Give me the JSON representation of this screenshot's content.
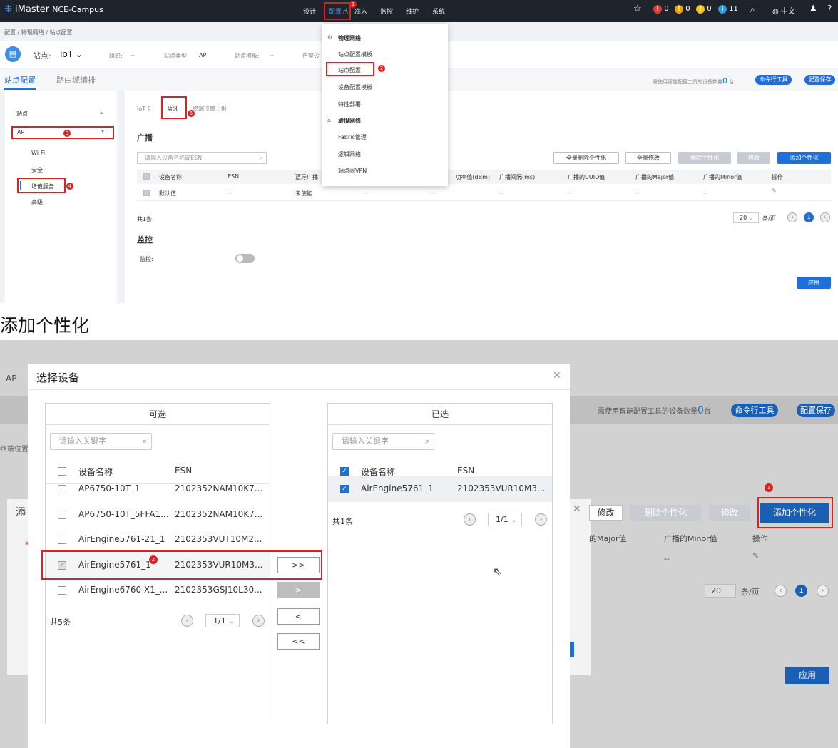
{
  "top": {
    "app_name_1": "iMaster",
    "app_name_2": "NCE-Campus",
    "nav": [
      "设计",
      "配置",
      "准入",
      "监控",
      "维护",
      "系统"
    ],
    "alarm_counts": [
      "0",
      "0",
      "0",
      "11"
    ],
    "lang": "中文",
    "breadcrumb": "配置 / 物理网络 / 站点配置",
    "site_label": "站点:",
    "site_value": "IoT",
    "org_label": "组织:",
    "org_value": "--",
    "type_label": "站点类型:",
    "type_value": "AP",
    "tmpl_label": "站点模板:",
    "tmpl_value": "--",
    "alarm_label": "告警设",
    "tabs": [
      "站点配置",
      "路由域编排"
    ],
    "device_count_text": "需使用智能配置工具的设备数量",
    "device_count": "0",
    "device_unit": "台",
    "cmd_tool": "命令行工具",
    "save_cfg": "配置保存",
    "left": {
      "site": "站点",
      "ap": "AP",
      "items": [
        "Wi-Fi",
        "安全",
        "增值服务",
        "高级"
      ]
    },
    "subtabs": [
      "IoT卡",
      "蓝牙",
      "终端位置上报"
    ],
    "section_broadcast": "广播",
    "search_placeholder": "请输入设备名称或ESN",
    "buttons": [
      "全量删除个性化",
      "全量修改",
      "删除个性化",
      "修改",
      "添加个性化"
    ],
    "columns": [
      "设备名称",
      "ESN",
      "蓝牙广播",
      "功率值(dBm)",
      "广播间隔(ms)",
      "广播的UUID值",
      "广播的Major值",
      "广播的Minor值",
      "操作"
    ],
    "row": [
      "默认值",
      "--",
      "未使能",
      "--",
      "--",
      "--",
      "--",
      "--",
      "--"
    ],
    "total": "共1条",
    "page_size": "20",
    "per_page": "条/页",
    "page": "1",
    "section_monitor": "监控",
    "monitor_label": "监控:",
    "apply": "应用",
    "dropdown": {
      "group1": "物理网络",
      "items1": [
        "站点配置模板",
        "站点配置",
        "设备配置模板",
        "特性部署"
      ],
      "group2": "虚拟网络",
      "items2": [
        "Fabric管理",
        "逻辑网络",
        "站点间VPN"
      ]
    },
    "badges": [
      "1",
      "2",
      "3",
      "4",
      "5"
    ]
  },
  "caption": "添加个性化",
  "bottom": {
    "bg_ap": "AP",
    "dialog_title": "选择设备",
    "left_title": "可选",
    "right_title": "已选",
    "search_placeholder": "请输入关键字",
    "col_name": "设备名称",
    "col_esn": "ESN",
    "available": [
      {
        "name": "AP6750-10T_1",
        "esn": "2102352NAM10K7..."
      },
      {
        "name": "AP6750-10T_5FFA1...",
        "esn": "2102352NAM10K7..."
      },
      {
        "name": "AirEngine5761-21_1",
        "esn": "2102353VUT10M2..."
      },
      {
        "name": "AirEngine5761_1",
        "esn": "2102353VUR10M3..."
      },
      {
        "name": "AirEngine6760-X1_...",
        "esn": "2102353GSJ10L30..."
      }
    ],
    "selected": [
      {
        "name": "AirEngine5761_1",
        "esn": "2102353VUR10M3..."
      }
    ],
    "left_total": "共5条",
    "right_total": "共1条",
    "page": "1/1",
    "move_buttons": [
      ">>",
      ">",
      "<",
      "<<"
    ],
    "bg_device_count_text": "需使用智能配置工具的设备数量",
    "bg_device_count": "0",
    "bg_unit": "台",
    "bg_cmd": "命令行工具",
    "bg_save": "配置保存",
    "bg_loc": "终端位置",
    "bg_add_prefix": "添",
    "bg_buttons": [
      "修改",
      "删除个性化",
      "修改",
      "添加个性化"
    ],
    "bg_cols": [
      "的Major值",
      "广播的Minor值",
      "操作"
    ],
    "bg_dash": "--",
    "bg_page_size": "20",
    "bg_per_page": "条/页",
    "bg_page": "1",
    "bg_apply": "应用",
    "badges": [
      "1",
      "2"
    ]
  }
}
